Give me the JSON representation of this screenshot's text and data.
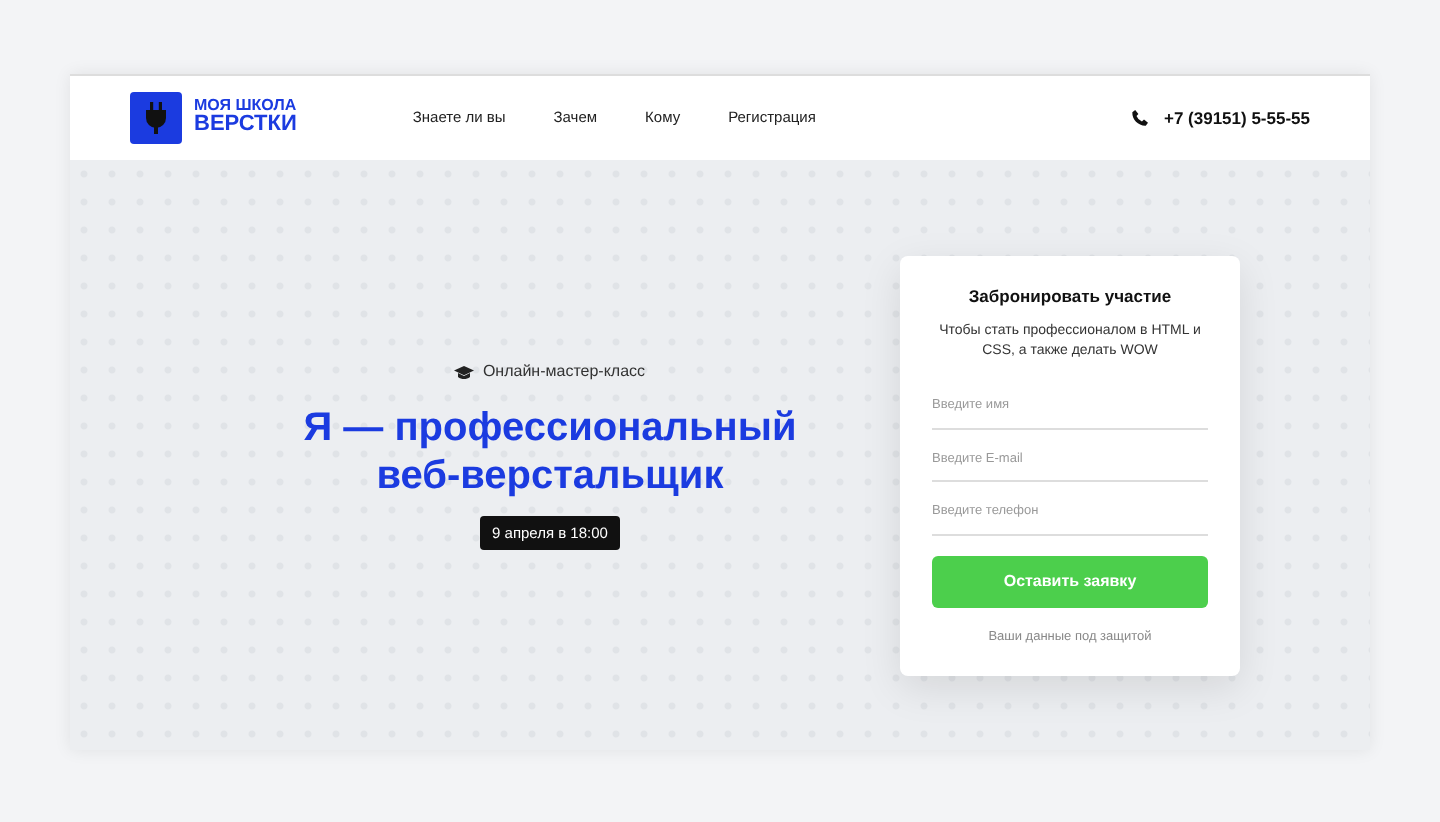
{
  "header": {
    "logo": {
      "line1": "МОЯ ШКОЛА",
      "line2": "ВЕРСТКИ"
    },
    "nav": [
      {
        "label": "Знаете ли вы"
      },
      {
        "label": "Зачем"
      },
      {
        "label": "Кому"
      },
      {
        "label": "Регистрация"
      }
    ],
    "phone": "+7 (39151) 5-55-55"
  },
  "hero": {
    "eyebrow": "Онлайн-мастер-класс",
    "title_line1": "Я — профессиональный",
    "title_line2": "веб-верстальщик",
    "date": "9 апреля в 18:00"
  },
  "form": {
    "title": "Забронировать участие",
    "subtitle": "Чтобы стать профессионалом в HTML и CSS, а также делать WOW",
    "fields": [
      {
        "placeholder": "Введите имя"
      },
      {
        "placeholder": "Введите E-mail"
      },
      {
        "placeholder": "Введите телефон"
      }
    ],
    "submit": "Оставить заявку",
    "note": "Ваши данные под защитой"
  }
}
